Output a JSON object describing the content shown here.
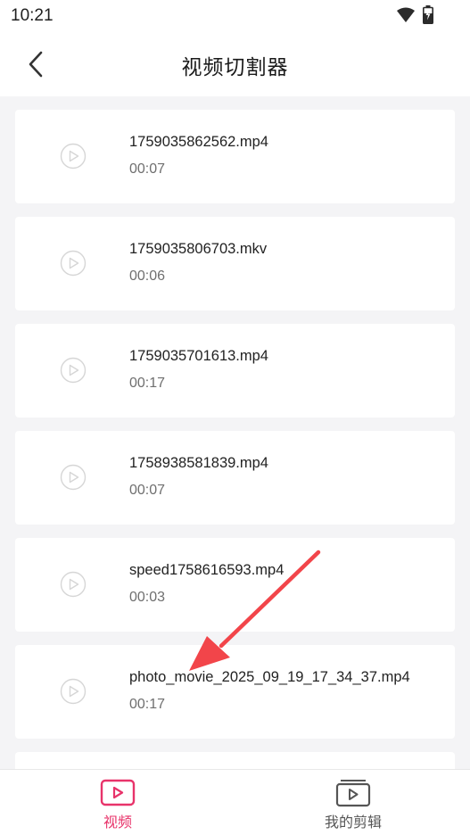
{
  "status_bar": {
    "time": "10:21"
  },
  "header": {
    "title": "视频切割器"
  },
  "videos": [
    {
      "name": "1759035862562.mp4",
      "duration": "00:07"
    },
    {
      "name": "1759035806703.mkv",
      "duration": "00:06"
    },
    {
      "name": "1759035701613.mp4",
      "duration": "00:17"
    },
    {
      "name": "1758938581839.mp4",
      "duration": "00:07"
    },
    {
      "name": "speed1758616593.mp4",
      "duration": "00:03"
    },
    {
      "name": "photo_movie_2025_09_19_17_34_37.mp4",
      "duration": "00:17"
    }
  ],
  "bottom_nav": {
    "videos_label": "视频",
    "my_edits_label": "我的剪辑",
    "active_color": "#e8336a",
    "inactive_color": "#555555"
  }
}
